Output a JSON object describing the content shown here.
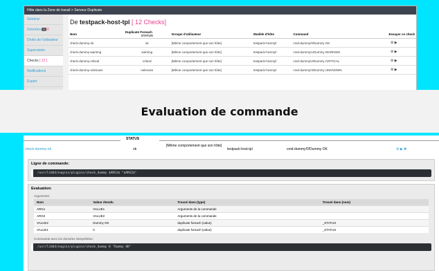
{
  "breadcrumb": "Hôte dans la Zone de travail > Serveur-Duplicate",
  "sidebar": {
    "items": [
      {
        "label": "Général",
        "badge": "",
        "badge2": ""
      },
      {
        "label": "Données",
        "badge": "3",
        "badge2": "/2"
      },
      {
        "label": "Droits de l'utilisateur",
        "badge": "",
        "badge2": ""
      },
      {
        "label": "Supervision",
        "badge": "",
        "badge2": ""
      },
      {
        "label": "Checks",
        "badge": "",
        "badge2": "[ 12 ]"
      },
      {
        "label": "Notifications",
        "badge": "",
        "badge2": ""
      },
      {
        "label": "Expert",
        "badge": "",
        "badge2": ""
      }
    ]
  },
  "heading": {
    "prefix": "De ",
    "host": "testpack-host-tpl",
    "count": " [ 12 Checks]"
  },
  "table": {
    "headers": {
      "name": "Nom",
      "dup": "Duplicate Foreach",
      "group": "Groupe d'utilisateur",
      "model": "Modèle d'hôte",
      "command": "Command",
      "try": "Essayer ce check"
    },
    "status_sub": "STATUS",
    "rows": [
      {
        "name": "check-dummy-ok",
        "dup": "ok",
        "group": "[Même comportement que son hôte]",
        "model": "testpack-host-tpl",
        "command": "cmd-dummy!0!Dummy OK"
      },
      {
        "name": "check-dummy-warning",
        "dup": "warning",
        "group": "[Même comportement que son hôte]",
        "model": "testpack-host-tpl",
        "command": "cmd-dummy!1!Dummy WARNING"
      },
      {
        "name": "check-dummy-critical",
        "dup": "critical",
        "group": "[Même comportement que son hôte]",
        "model": "testpack-host-tpl",
        "command": "cmd-dummy!2!Dummy CRITICAL"
      },
      {
        "name": "check-dummy-unknown",
        "dup": "unknown",
        "group": "[Même comportement que son hôte]",
        "model": "testpack-host-tpl",
        "command": "cmd-dummy!3!Dummy UNKNOWN"
      }
    ],
    "action_icons": "⚙ ▶"
  },
  "title_band": "Evaluation de commande",
  "detail": {
    "status_header": "STATUS",
    "row": {
      "name": "check-dummy-ok",
      "dup": "ok",
      "group": "[Même comportement que son hôte]",
      "model": "testpack-host-tpl",
      "command": "cmd-dummy!0!Dummy OK",
      "icons": "⚙ ▶ ✖"
    },
    "cmdline_title": "Ligne de commande:",
    "cmdline": "/usr/lib64/nagios/plugins/check_dummy $ARG1$ \"$ARG2$\"",
    "eval_title": "Evaluation:",
    "args_label": "Arguments:",
    "args_headers": [
      "Nom",
      "Valeur étendu",
      "Trouvé dans (type)",
      "Trouvé dans (nom)"
    ],
    "args_rows": [
      [
        "ARG1",
        "VALUE1",
        "Arguments de la commande",
        ""
      ],
      [
        "ARG2",
        "VALUE2",
        "Arguments de la commande",
        ""
      ],
      [
        "VALUE2",
        "Dummy OK",
        "duplicate foreach (value)",
        "_STATUS"
      ],
      [
        "VALUE1",
        "0",
        "duplicate foreach (value)",
        "_STATUS"
      ]
    ],
    "interpreted_label": "Commande avec les données interprétées:",
    "interpreted": "/usr/lib64/nagios/plugins/check_dummy 0 \"Dummy OK\""
  }
}
